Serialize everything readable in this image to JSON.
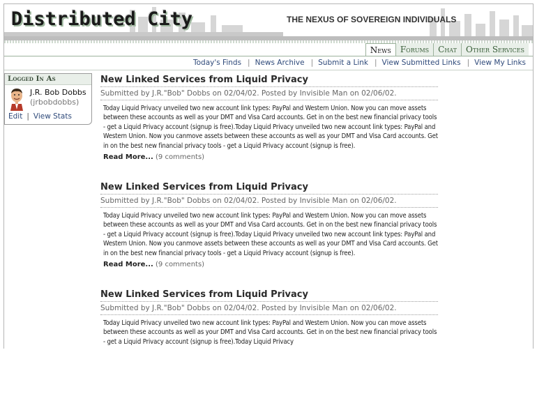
{
  "site": {
    "logo_text": "Distributed City",
    "tagline": "THE NEXUS OF SOVEREIGN INDIVIDUALS"
  },
  "tabs": [
    {
      "label": "News",
      "active": true
    },
    {
      "label": "Forums",
      "active": false
    },
    {
      "label": "Chat",
      "active": false
    },
    {
      "label": "Other Services",
      "active": false
    }
  ],
  "subnav": [
    {
      "label": "Today's Finds"
    },
    {
      "label": "News Archive"
    },
    {
      "label": "Submit a Link"
    },
    {
      "label": "View Submitted Links"
    },
    {
      "label": "View My Links"
    }
  ],
  "login": {
    "heading": "Logged In As",
    "name": "J.R. Bob Dobbs",
    "handle": "(jrbobdobbs)",
    "edit_label": "Edit",
    "stats_label": "View Stats"
  },
  "articles": [
    {
      "title": "New Linked Services from Liquid Privacy",
      "meta": "Submitted by J.R.\"Bob\" Dobbs on  02/04/02.  Posted by Invisible Man on 02/06/02.",
      "body": "Today Liquid Privacy unveiled two new account link types: PayPal and Western Union. Now you can move assets between these accounts as well as your DMT and Visa Card accounts. Get in on the best new financial privacy tools - get a Liquid Privacy account (signup is free).Today Liquid Privacy unveiled two new account link types: PayPal and Western Union. Now you canmove assets between these accounts as well as your DMT and Visa Card accounts. Get in on the best new financial privacy tools - get a Liquid Privacy account (signup is free).",
      "read_more": "Read More...",
      "comments": "(9 comments)"
    },
    {
      "title": "New Linked Services from Liquid Privacy",
      "meta": "Submitted by J.R.\"Bob\" Dobbs on  02/04/02.  Posted by Invisible Man on 02/06/02.",
      "body": "Today Liquid Privacy unveiled two new account link types: PayPal and Western Union. Now you can move assets between these accounts as well as your DMT and Visa Card accounts. Get in on the best new financial privacy tools - get a Liquid Privacy account (signup is free).Today Liquid Privacy unveiled two new account link types: PayPal and Western Union. Now you canmove assets between these accounts as well as your DMT and Visa Card accounts. Get in on the best new financial privacy tools - get a Liquid Privacy account (signup is free).",
      "read_more": "Read More...",
      "comments": "(9 comments)"
    },
    {
      "title": "New Linked Services from Liquid Privacy",
      "meta": "Submitted by J.R.\"Bob\" Dobbs on  02/04/02.  Posted by Invisible Man on 02/06/02.",
      "body": "Today Liquid Privacy unveiled two new account link types: PayPal and Western Union. Now you can move assets between these accounts as well as your DMT and Visa Card accounts. Get in on the best new financial privacy tools - get a Liquid Privacy account (signup is free).Today Liquid Privacy",
      "read_more": "",
      "comments": ""
    }
  ],
  "colors": {
    "accent_green": "#9cb29c",
    "link_blue": "#2f4a7a",
    "tab_bg": "#e9efe9"
  }
}
